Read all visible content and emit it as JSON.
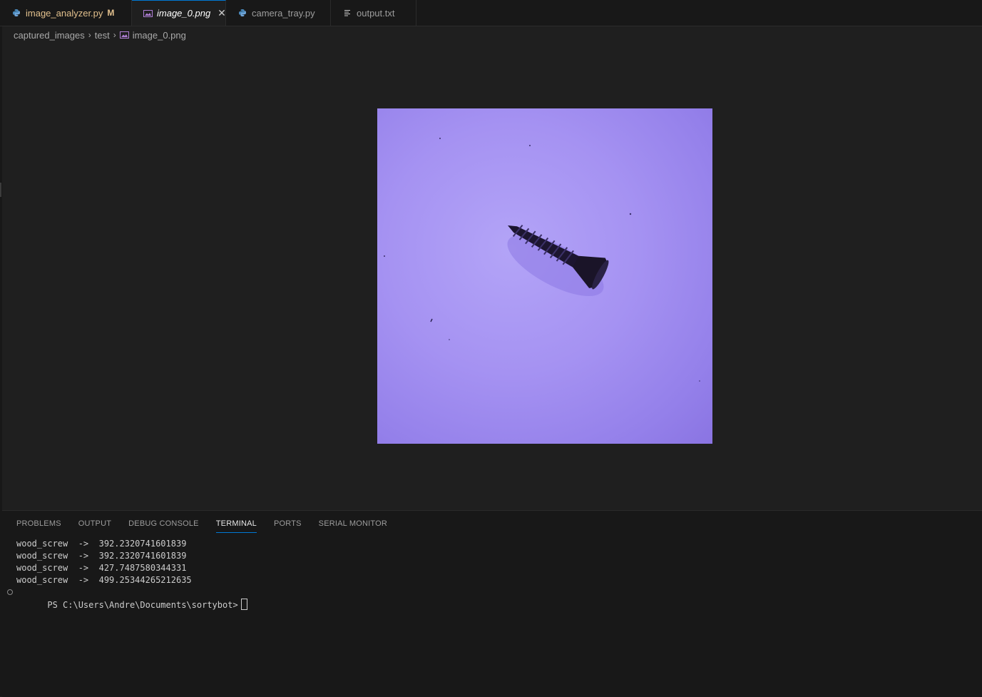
{
  "tabs": [
    {
      "label": "image_analyzer.py",
      "icon": "python-icon",
      "modified_badge": "M",
      "active": false
    },
    {
      "label": "image_0.png",
      "icon": "image-icon",
      "close": "✕",
      "active": true
    },
    {
      "label": "camera_tray.py",
      "icon": "python-icon",
      "active": false
    },
    {
      "label": "output.txt",
      "icon": "text-file-icon",
      "active": false
    }
  ],
  "breadcrumb": {
    "parts": [
      "captured_images",
      "test",
      "image_0.png"
    ],
    "separator": "›"
  },
  "preview": {
    "subject": "black wood screw on purple background",
    "background_color": "#a592f2"
  },
  "panel": {
    "tabs": [
      "PROBLEMS",
      "OUTPUT",
      "DEBUG CONSOLE",
      "TERMINAL",
      "PORTS",
      "SERIAL MONITOR"
    ],
    "active_tab": "TERMINAL"
  },
  "terminal": {
    "lines": [
      "wood_screw  ->  392.2320741601839",
      "wood_screw  ->  392.2320741601839",
      "wood_screw  ->  427.7487580344331",
      "wood_screw  ->  499.25344265212635"
    ],
    "prompt": "PS C:\\Users\\Andre\\Documents\\sortybot>"
  },
  "colors": {
    "accent": "#0078d4",
    "modified": "#e2c08d",
    "python": "#4b8bbe",
    "image_icon": "#b180d7"
  }
}
